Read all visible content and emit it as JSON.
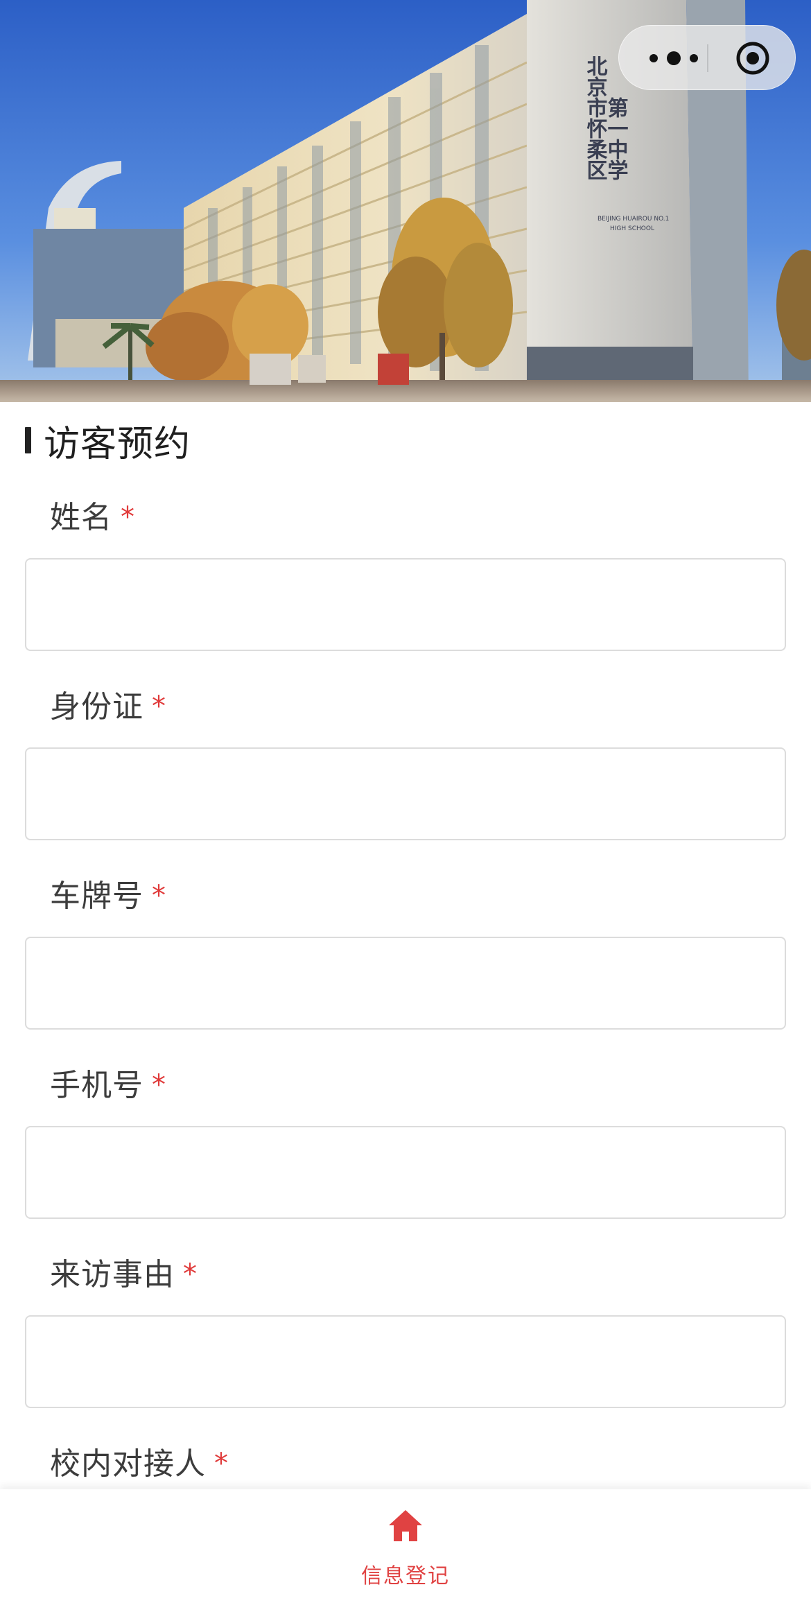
{
  "hero": {
    "image_alt": "school building photo",
    "building_sign_cn_line1": "第一中学",
    "building_sign_cn_line2": "北京市怀柔区",
    "building_sign_en_line1": "BEIJING HUAIROU NO.1",
    "building_sign_en_line2": "HIGH SCHOOL"
  },
  "capsule": {
    "more_icon": "more-dots-icon",
    "close_icon": "target-circle-icon"
  },
  "section": {
    "title": "访客预约"
  },
  "form": {
    "required_mark": "*",
    "fields": [
      {
        "label": "姓名",
        "value": "",
        "placeholder": ""
      },
      {
        "label": "身份证",
        "value": "",
        "placeholder": ""
      },
      {
        "label": "车牌号",
        "value": "",
        "placeholder": ""
      },
      {
        "label": "手机号",
        "value": "",
        "placeholder": ""
      },
      {
        "label": "来访事由",
        "value": "",
        "placeholder": ""
      },
      {
        "label": "校内对接人",
        "value": "",
        "placeholder": ""
      }
    ]
  },
  "tabbar": {
    "items": [
      {
        "label": "信息登记",
        "icon": "home-icon",
        "active": true
      }
    ],
    "active_color": "#e04242"
  },
  "colors": {
    "required": "#e03a3a",
    "accent": "#e04242"
  }
}
